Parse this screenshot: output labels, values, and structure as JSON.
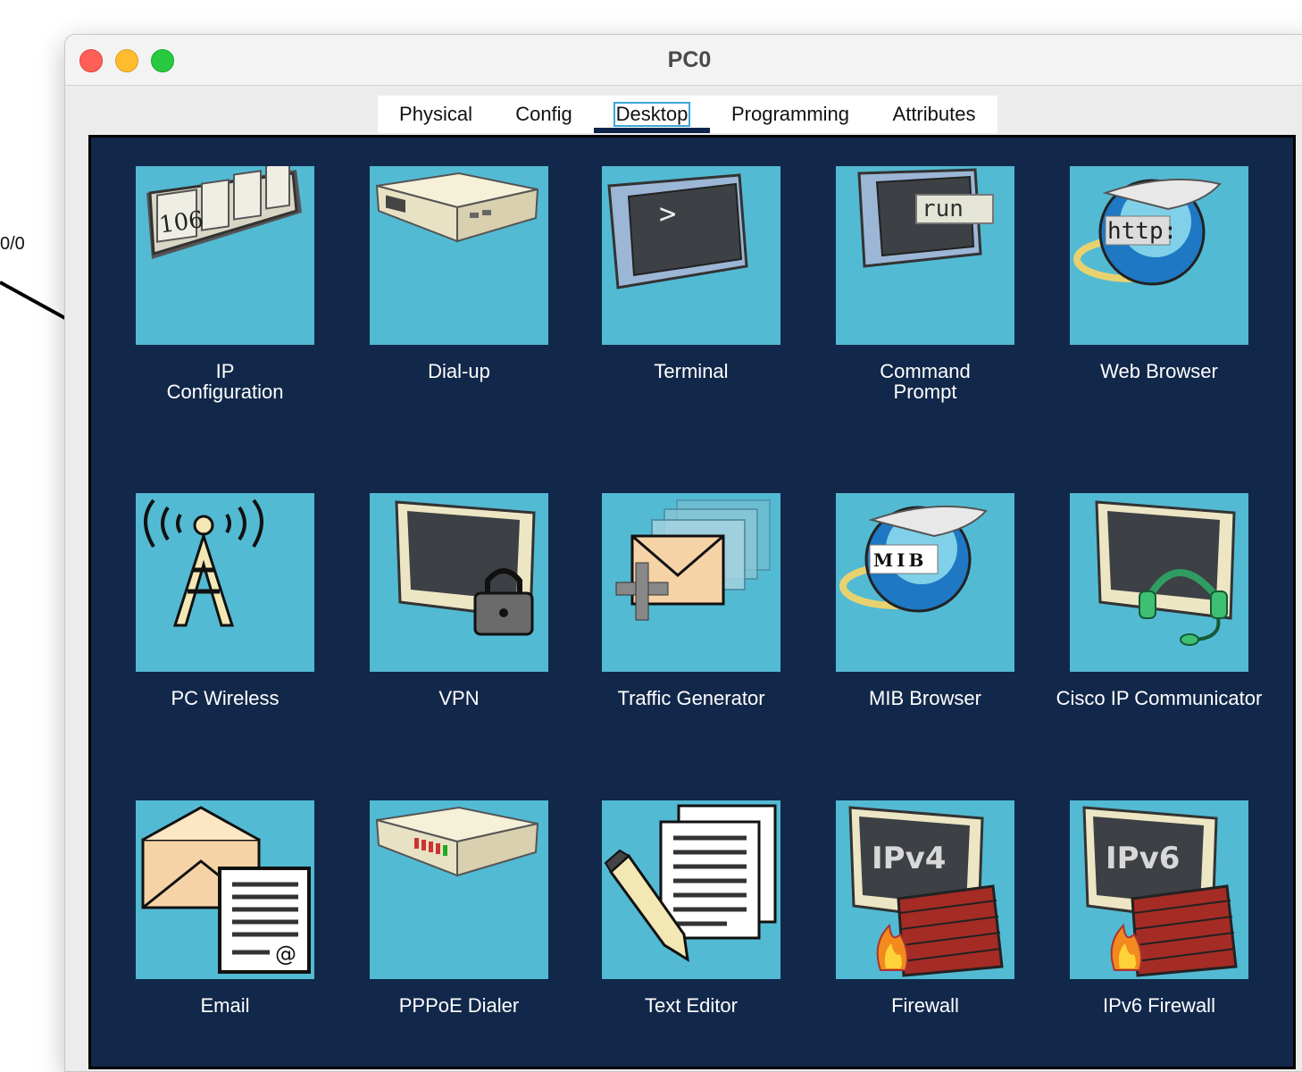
{
  "background": {
    "link_label": "0/0"
  },
  "window": {
    "title": "PC0"
  },
  "tabs": [
    {
      "label": "Physical"
    },
    {
      "label": "Config"
    },
    {
      "label": "Desktop"
    },
    {
      "label": "Programming"
    },
    {
      "label": "Attributes"
    }
  ],
  "active_tab": "Desktop",
  "apps": [
    {
      "label": "IP\nConfiguration",
      "icon": "ip-configuration-icon",
      "icon_text": "106"
    },
    {
      "label": "Dial-up",
      "icon": "dialup-modem-icon"
    },
    {
      "label": "Terminal",
      "icon": "terminal-icon",
      "icon_text": ">"
    },
    {
      "label": "Command\nPrompt",
      "icon": "command-prompt-icon",
      "icon_text": "run"
    },
    {
      "label": "Web Browser",
      "icon": "web-browser-icon",
      "icon_text": "http:"
    },
    {
      "label": "PC Wireless",
      "icon": "wireless-tower-icon"
    },
    {
      "label": "VPN",
      "icon": "vpn-monitor-lock-icon"
    },
    {
      "label": "Traffic Generator",
      "icon": "traffic-generator-icon"
    },
    {
      "label": "MIB Browser",
      "icon": "mib-browser-icon",
      "icon_text": "MIB"
    },
    {
      "label": "Cisco IP Communicator",
      "icon": "ip-communicator-headset-icon"
    },
    {
      "label": "Email",
      "icon": "email-icon",
      "icon_text": "@"
    },
    {
      "label": "PPPoE Dialer",
      "icon": "pppoe-dialer-icon"
    },
    {
      "label": "Text Editor",
      "icon": "text-editor-icon"
    },
    {
      "label": "Firewall",
      "icon": "firewall-ipv4-icon",
      "icon_text": "IPv4"
    },
    {
      "label": "IPv6 Firewall",
      "icon": "firewall-ipv6-icon",
      "icon_text": "IPv6"
    }
  ],
  "colors": {
    "desktop_bg": "#12284a",
    "icon_bg": "#53bad3",
    "tab_underline": "#0d2449"
  }
}
